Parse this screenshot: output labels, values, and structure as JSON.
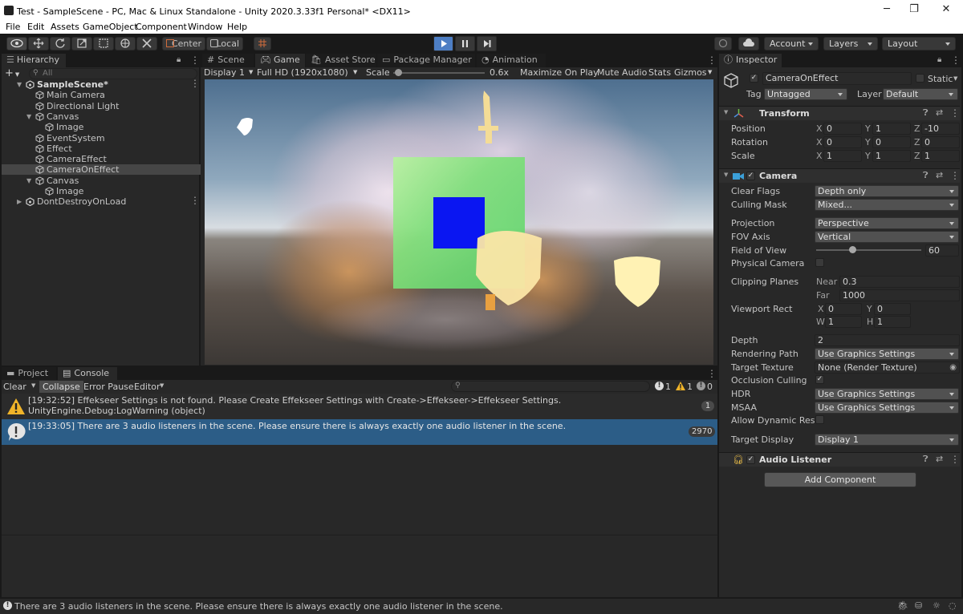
{
  "window": {
    "title": "Test - SampleScene - PC, Mac & Linux Standalone - Unity 2020.3.33f1 Personal* <DX11>",
    "minimize": "─",
    "maximize": "❐",
    "close": "✕"
  },
  "menu": [
    "File",
    "Edit",
    "Assets",
    "GameObject",
    "Component",
    "Window",
    "Help"
  ],
  "toolbar": {
    "pivot_label": "Center",
    "space_label": "Local",
    "account": "Account",
    "layers": "Layers",
    "layout": "Layout",
    "play_active": true
  },
  "hierarchy": {
    "tab": "Hierarchy",
    "search_placeholder": "All",
    "add": "+",
    "items": [
      {
        "label": "SampleScene*",
        "depth": 0,
        "kind": "scene",
        "fold": "open",
        "bold": true
      },
      {
        "label": "Main Camera",
        "depth": 1,
        "kind": "obj"
      },
      {
        "label": "Directional Light",
        "depth": 1,
        "kind": "obj"
      },
      {
        "label": "Canvas",
        "depth": 1,
        "kind": "obj",
        "fold": "open"
      },
      {
        "label": "Image",
        "depth": 2,
        "kind": "obj"
      },
      {
        "label": "EventSystem",
        "depth": 1,
        "kind": "obj"
      },
      {
        "label": "Effect",
        "depth": 1,
        "kind": "obj"
      },
      {
        "label": "CameraEffect",
        "depth": 1,
        "kind": "obj"
      },
      {
        "label": "CameraOnEffect",
        "depth": 1,
        "kind": "obj",
        "selected": true
      },
      {
        "label": "Canvas",
        "depth": 1,
        "kind": "obj",
        "fold": "open"
      },
      {
        "label": "Image",
        "depth": 2,
        "kind": "obj"
      },
      {
        "label": "DontDestroyOnLoad",
        "depth": 0,
        "kind": "scene",
        "fold": "closed"
      }
    ]
  },
  "center_tabs": {
    "scene": "Scene",
    "game": "Game",
    "asset_store": "Asset Store",
    "package_manager": "Package Manager",
    "animation": "Animation"
  },
  "game_bar": {
    "display": "Display 1",
    "resolution": "Full HD (1920x1080)",
    "scale_label": "Scale",
    "scale_value": "0.6x",
    "scale_fraction": 0.05,
    "maximize": "Maximize On Play",
    "mute": "Mute Audio",
    "stats": "Stats",
    "gizmos": "Gizmos"
  },
  "bottom_tabs": {
    "project": "Project",
    "console": "Console"
  },
  "console_bar": {
    "clear": "Clear",
    "collapse": "Collapse",
    "error_pause": "Error Pause",
    "editor": "Editor",
    "search_placeholder": "",
    "log_count": "1",
    "warn_count": "1",
    "error_count": "0"
  },
  "console_entries": [
    {
      "line1": "[19:32:52] Effekseer Settings is not found. Please Create Effekseer Settings with Create->Effekseer->Effekseer Settings.",
      "line2": "UnityEngine.Debug:LogWarning (object)",
      "count": "1",
      "type": "warning"
    },
    {
      "line1": "[19:33:05] There are 3 audio listeners in the scene. Please ensure there is always exactly one audio listener in the scene.",
      "line2": "",
      "count": "2970",
      "type": "info",
      "selected": true
    }
  ],
  "inspector": {
    "tab": "Inspector",
    "object_name": "CameraOnEffect",
    "static_label": "Static",
    "tag_label": "Tag",
    "tag_value": "Untagged",
    "layer_label": "Layer",
    "layer_value": "Default",
    "transform": {
      "title": "Transform",
      "position_label": "Position",
      "position": [
        "0",
        "1",
        "-10"
      ],
      "rotation_label": "Rotation",
      "rotation": [
        "0",
        "0",
        "0"
      ],
      "scale_label": "Scale",
      "scale": [
        "1",
        "1",
        "1"
      ]
    },
    "camera": {
      "title": "Camera",
      "clear_flags_label": "Clear Flags",
      "clear_flags": "Depth only",
      "culling_mask_label": "Culling Mask",
      "culling_mask": "Mixed...",
      "projection_label": "Projection",
      "projection": "Perspective",
      "fov_axis_label": "FOV Axis",
      "fov_axis": "Vertical",
      "fov_label": "Field of View",
      "fov": "60",
      "fov_fraction": 0.343,
      "physical_label": "Physical Camera",
      "clipping_label": "Clipping Planes",
      "near_label": "Near",
      "near": "0.3",
      "far_label": "Far",
      "far": "1000",
      "viewport_label": "Viewport Rect",
      "vx": "0",
      "vy": "0",
      "vw": "1",
      "vh": "1",
      "depth_label": "Depth",
      "depth": "2",
      "rendering_path_label": "Rendering Path",
      "rendering_path": "Use Graphics Settings",
      "target_texture_label": "Target Texture",
      "target_texture": "None (Render Texture)",
      "occlusion_label": "Occlusion Culling",
      "hdr_label": "HDR",
      "hdr": "Use Graphics Settings",
      "msaa_label": "MSAA",
      "msaa": "Use Graphics Settings",
      "dynres_label": "Allow Dynamic Resol",
      "target_display_label": "Target Display",
      "target_display": "Display 1"
    },
    "audio_listener": {
      "title": "Audio Listener"
    },
    "add_component": "Add Component"
  },
  "statusbar": {
    "message": "There are 3 audio listeners in the scene. Please ensure there is always exactly one audio listener in the scene."
  },
  "colors": {
    "accent_blue": "#4d7ec4",
    "selection_row": "#2c5d87",
    "game_blue_square": "#0a16f2",
    "warning_yellow": "#f0b429"
  }
}
